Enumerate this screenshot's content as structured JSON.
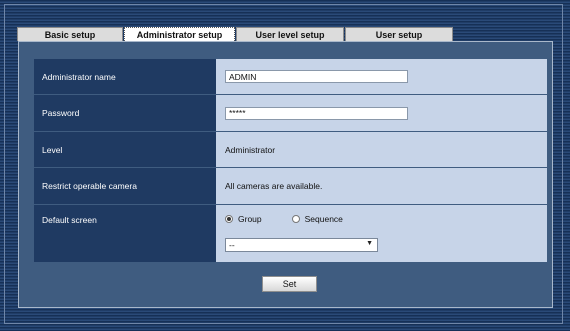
{
  "tabs": [
    {
      "label": "Basic setup",
      "active": false
    },
    {
      "label": "Administrator setup",
      "active": true
    },
    {
      "label": "User level setup",
      "active": false
    },
    {
      "label": "User setup",
      "active": false
    }
  ],
  "form": {
    "admin_name": {
      "label": "Administrator name",
      "value": "ADMIN"
    },
    "password": {
      "label": "Password",
      "value": "*****"
    },
    "level": {
      "label": "Level",
      "value": "Administrator"
    },
    "restrict": {
      "label": "Restrict operable camera",
      "value": "All cameras are available."
    },
    "default_screen": {
      "label": "Default screen",
      "options": [
        {
          "label": "Group",
          "selected": true
        },
        {
          "label": "Sequence",
          "selected": false
        }
      ],
      "select_value": "--"
    }
  },
  "set_button": "Set",
  "colors": {
    "label_bg": "#1f3a62",
    "value_bg": "#c7d4e8",
    "panel_bg": "#3f5c80"
  }
}
